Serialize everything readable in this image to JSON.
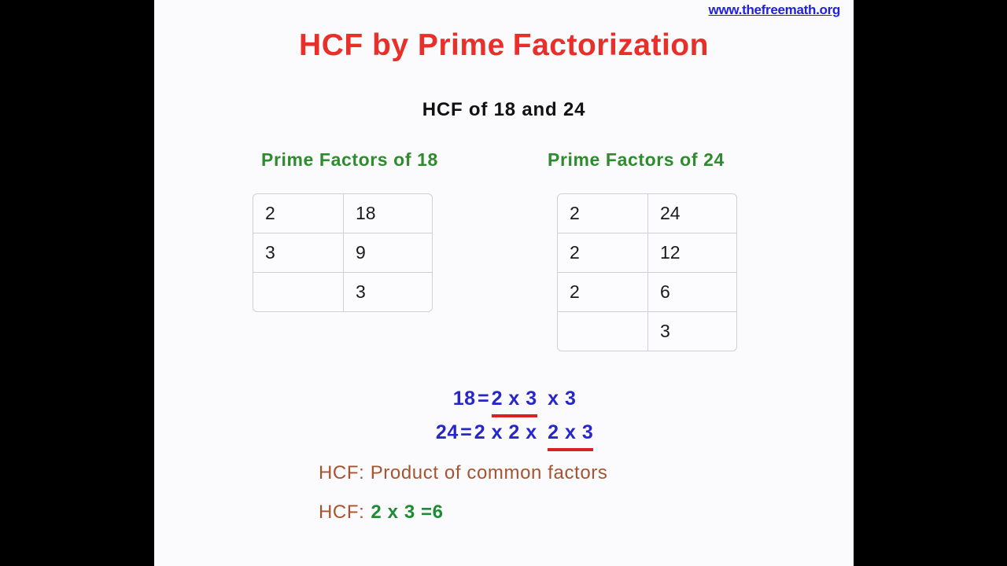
{
  "watermark": {
    "text": "www.thefreemath.org",
    "color": "#2020dd"
  },
  "title": {
    "part1": "HCF by Prime",
    "part2": "Factorization",
    "color": "#e8302a"
  },
  "subtitle": {
    "text": "HCF of 18 and 24",
    "color": "#111111"
  },
  "columns": {
    "left": {
      "header": "Prime Factors of 18",
      "header_color": "#2e8b2e",
      "number": "18",
      "rows": [
        {
          "divisor": "2",
          "dividend": "18"
        },
        {
          "divisor": "3",
          "dividend": "9"
        },
        {
          "divisor": "",
          "dividend": "3"
        }
      ]
    },
    "right": {
      "header": "Prime Factors of 24",
      "header_color": "#2e8b2e",
      "number": "24",
      "rows": [
        {
          "divisor": "2",
          "dividend": "24"
        },
        {
          "divisor": "2",
          "dividend": "12"
        },
        {
          "divisor": "2",
          "dividend": "6"
        },
        {
          "divisor": "",
          "dividend": "3"
        }
      ]
    }
  },
  "equations": {
    "color": "#2626cc",
    "underline_color": "#d92121",
    "times_symbol": "x",
    "equals_symbol": "=",
    "line1": {
      "lhs": "18",
      "marked": "2 x 3",
      "tail": "x 3",
      "full": "18 = 2 x 3 x 3"
    },
    "line2": {
      "lhs": "24",
      "head": "2 x 2 x",
      "marked": "2 x 3",
      "full": "24 = 2 x 2 x 2 x 3"
    }
  },
  "hcf": {
    "label": "HCF:",
    "rule_text": "Product of common factors",
    "rule_color": "#a65430",
    "answer_expression": "2 x 3 =",
    "answer_value": "6",
    "answer_color": "#1f8b35"
  }
}
